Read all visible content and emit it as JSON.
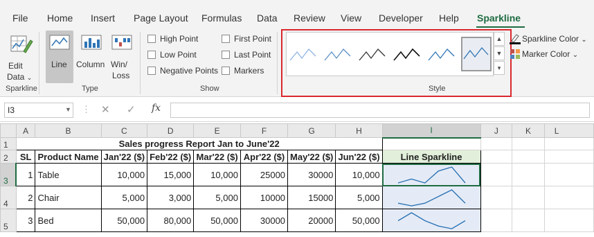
{
  "tabs": [
    "File",
    "Home",
    "Insert",
    "Page Layout",
    "Formulas",
    "Data",
    "Review",
    "View",
    "Developer",
    "Help",
    "Sparkline"
  ],
  "active_tab": "Sparkline",
  "ribbon": {
    "sparkline_group": {
      "edit_data_line1": "Edit",
      "edit_data_line2": "Data",
      "label": "Sparkline"
    },
    "type_group": {
      "line": "Line",
      "column": "Column",
      "winloss_line1": "Win/",
      "winloss_line2": "Loss",
      "label": "Type"
    },
    "show_group": {
      "high_point": "High Point",
      "low_point": "Low Point",
      "negative_points": "Negative Points",
      "first_point": "First Point",
      "last_point": "Last Point",
      "markers": "Markers",
      "label": "Show"
    },
    "style_group": {
      "label": "Style"
    },
    "sparkline_color": "Sparkline Color",
    "marker_color": "Marker Color"
  },
  "formula_bar": {
    "name_box": "I3",
    "fx": "fx",
    "value": ""
  },
  "columns": [
    "A",
    "B",
    "C",
    "D",
    "E",
    "F",
    "G",
    "H",
    "I",
    "J",
    "K",
    "L"
  ],
  "selected_column": "I",
  "rows": [
    "1",
    "2",
    "3",
    "4",
    "5"
  ],
  "selected_row": "3",
  "sheet": {
    "title": "Sales progress Report Jan to June'22",
    "headers": [
      "SL",
      "Product Name",
      "Jan'22 ($)",
      "Feb'22 ($)",
      "Mar'22 ($)",
      "Apr'22 ($)",
      "May'22 ($)",
      "Jun'22 ($)",
      "Line Sparkline"
    ],
    "data": [
      {
        "sl": "1",
        "name": "Table",
        "values": [
          "10,000",
          "15,000",
          "10,000",
          "25000",
          "30000",
          "10,000"
        ],
        "series": [
          10000,
          15000,
          10000,
          25000,
          30000,
          10000
        ]
      },
      {
        "sl": "2",
        "name": "Chair",
        "values": [
          "5,000",
          "3,000",
          "5,000",
          "10000",
          "15000",
          "5,000"
        ],
        "series": [
          5000,
          3000,
          5000,
          10000,
          15000,
          5000
        ]
      },
      {
        "sl": "3",
        "name": "Bed",
        "values": [
          "50,000",
          "80,000",
          "50,000",
          "30000",
          "20000",
          "50,000"
        ],
        "series": [
          50000,
          80000,
          50000,
          30000,
          20000,
          50000
        ]
      }
    ]
  },
  "colors": {
    "accent": "#1e6b41",
    "sparkline": "#2e75b6",
    "style_highlight": "#d9282e"
  }
}
